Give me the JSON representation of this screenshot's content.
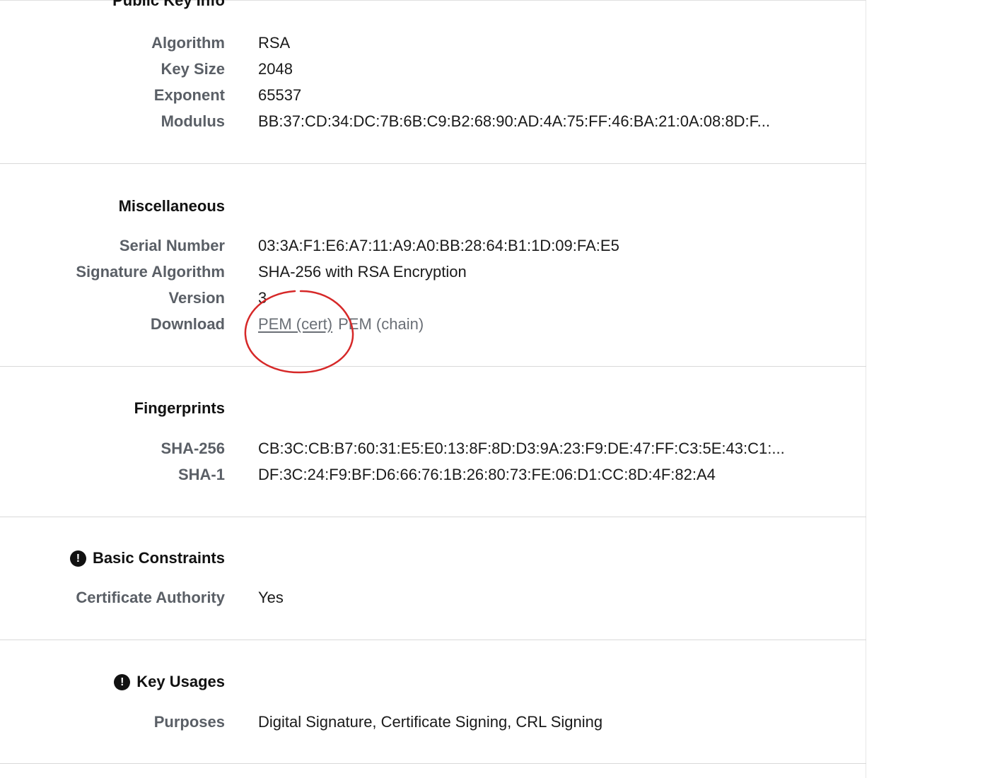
{
  "public_key_info": {
    "title": "Public Key Info",
    "rows": [
      {
        "label": "Algorithm",
        "value": "RSA"
      },
      {
        "label": "Key Size",
        "value": "2048"
      },
      {
        "label": "Exponent",
        "value": "65537"
      },
      {
        "label": "Modulus",
        "value": "BB:37:CD:34:DC:7B:6B:C9:B2:68:90:AD:4A:75:FF:46:BA:21:0A:08:8D:F..."
      }
    ]
  },
  "miscellaneous": {
    "title": "Miscellaneous",
    "rows": [
      {
        "label": "Serial Number",
        "value": "03:3A:F1:E6:A7:11:A9:A0:BB:28:64:B1:1D:09:FA:E5"
      },
      {
        "label": "Signature Algorithm",
        "value": "SHA-256 with RSA Encryption"
      },
      {
        "label": "Version",
        "value": "3"
      }
    ],
    "download": {
      "label": "Download",
      "pem_cert": "PEM (cert)",
      "pem_chain": "PEM (chain)"
    }
  },
  "fingerprints": {
    "title": "Fingerprints",
    "rows": [
      {
        "label": "SHA-256",
        "value": "CB:3C:CB:B7:60:31:E5:E0:13:8F:8D:D3:9A:23:F9:DE:47:FF:C3:5E:43:C1:..."
      },
      {
        "label": "SHA-1",
        "value": "DF:3C:24:F9:BF:D6:66:76:1B:26:80:73:FE:06:D1:CC:8D:4F:82:A4"
      }
    ]
  },
  "basic_constraints": {
    "title": "Basic Constraints",
    "icon": "exclamation-icon",
    "rows": [
      {
        "label": "Certificate Authority",
        "value": "Yes"
      }
    ]
  },
  "key_usages": {
    "title": "Key Usages",
    "icon": "exclamation-icon",
    "rows": [
      {
        "label": "Purposes",
        "value": "Digital Signature, Certificate Signing, CRL Signing"
      }
    ]
  },
  "colors": {
    "label": "#5a5f66",
    "title": "#111111",
    "value": "#1a1a1a",
    "annotation": "#d62828",
    "divider": "#d9d9d9"
  }
}
